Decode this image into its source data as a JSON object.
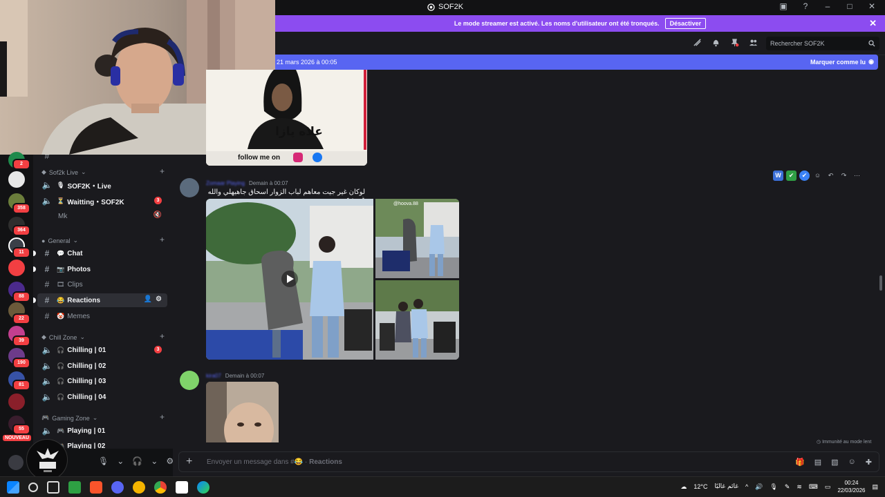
{
  "window": {
    "title": "SOF2K"
  },
  "streamer_banner": {
    "text": "Le mode streamer est activé. Les noms d'utilisateur ont été tronqués.",
    "button": "Désactiver"
  },
  "header": {
    "search_placeholder": "Rechercher SOF2K"
  },
  "new_messages": {
    "date": "21 mars 2026 à 00:05",
    "mark_read": "Marquer comme lu"
  },
  "servers": {
    "badges": [
      "2",
      "358",
      "364",
      "11",
      "88",
      "22",
      "39",
      "190",
      "81",
      "55"
    ],
    "new_label": "NOUVEAU"
  },
  "channels": {
    "categories": [
      {
        "name": "Sof2k Live"
      },
      {
        "name": "General"
      },
      {
        "name": "Chill Zone"
      },
      {
        "name": "Gaming Zone"
      }
    ],
    "live": [
      {
        "label": "SOF2K・Live",
        "emoji": "🎙"
      },
      {
        "label": "Waitting・SOF2K",
        "emoji": "⏳",
        "badge": "3"
      }
    ],
    "user_in_voice": "Mk",
    "general": [
      {
        "label": "Chat",
        "emoji": "💬"
      },
      {
        "label": "Photos",
        "emoji": "📷"
      },
      {
        "label": "Clips",
        "emoji": "🎞"
      },
      {
        "label": "Reactions",
        "emoji": "😂"
      },
      {
        "label": "Memes",
        "emoji": "🤡"
      }
    ],
    "chill": [
      {
        "label": "Chilling | 01",
        "badge": "3"
      },
      {
        "label": "Chilling | 02"
      },
      {
        "label": "Chilling | 03"
      },
      {
        "label": "Chilling | 04"
      }
    ],
    "gaming": [
      {
        "label": "Playing | 01"
      },
      {
        "label": "Playing | 02"
      }
    ]
  },
  "messages": [
    {
      "author": "Zomaar Playing",
      "time": "Demain à 00:07",
      "text": "لوكان غير جيت معاهم لباب الزوار اسحاق جاهيهلي والله غير زعيم",
      "image_tag": "@hoova.88"
    },
    {
      "author": "kira07",
      "time": "Demain à 00:07"
    }
  ],
  "gif_caption": {
    "arabic": "علاه يازا",
    "follow": "follow me on"
  },
  "immunity": "Immunité au mode lent",
  "composer": {
    "placeholder_prefix": "Envoyer un message dans #",
    "channel": "Reactions"
  },
  "taskbar": {
    "weather": "12°C",
    "weather_text": "غائم غالبًا",
    "time": "00:24",
    "date": "22/03/2026"
  },
  "colors": {
    "accent": "#5865f2",
    "banner": "#8c4cf0",
    "badge": "#f23f42"
  }
}
